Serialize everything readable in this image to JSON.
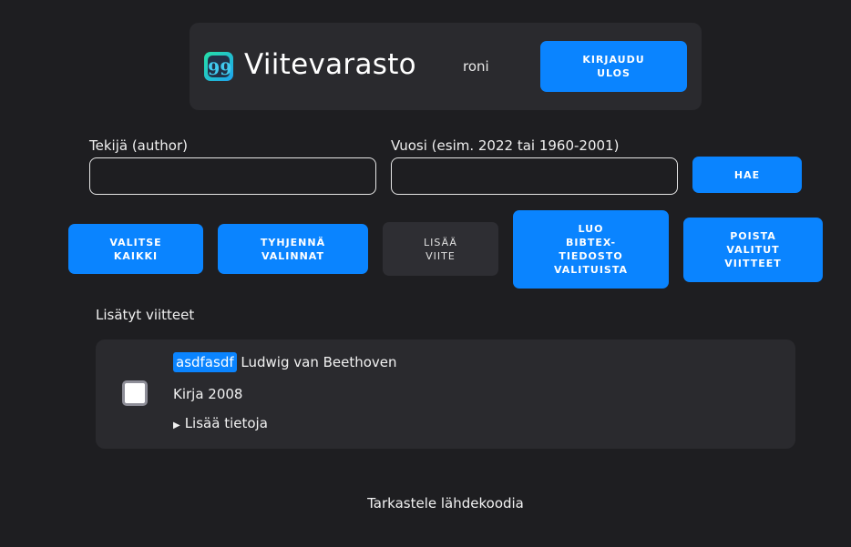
{
  "header": {
    "title": "Viitevarasto",
    "logo_icon": "quote-icon",
    "logo_glyph": "99",
    "username": "roni",
    "logout_label": "KIRJAUDU\nULOS"
  },
  "search": {
    "author_label": "Tekijä (author)",
    "author_value": "",
    "year_label": "Vuosi (esim. 2022 tai 1960-2001)",
    "year_value": "",
    "search_label": "HAE"
  },
  "actions": {
    "select_all": "VALITSE\nKAIKKI",
    "clear_selection": "TYHJENNÄ\nVALINNAT",
    "add_reference": "LISÄÄ\nVIITE",
    "create_bibtex": "LUO\nBIBTEX-\nTIEDOSTO\nVALITUISTA",
    "delete_selected": "POISTA\nVALITUT\nVIITTEET"
  },
  "references": {
    "section_title": "Lisätyt viitteet",
    "items": [
      {
        "key": "asdfasdf",
        "author": "Ludwig van Beethoven",
        "type_year": "Kirja 2008",
        "more_info": "Lisää tietoja",
        "checked": false
      }
    ]
  },
  "footer": {
    "source_link": "Tarkastele lähdekoodia"
  },
  "colors": {
    "background": "#1e1e21",
    "panel": "#2a2a2e",
    "accent": "#0a84ff"
  }
}
